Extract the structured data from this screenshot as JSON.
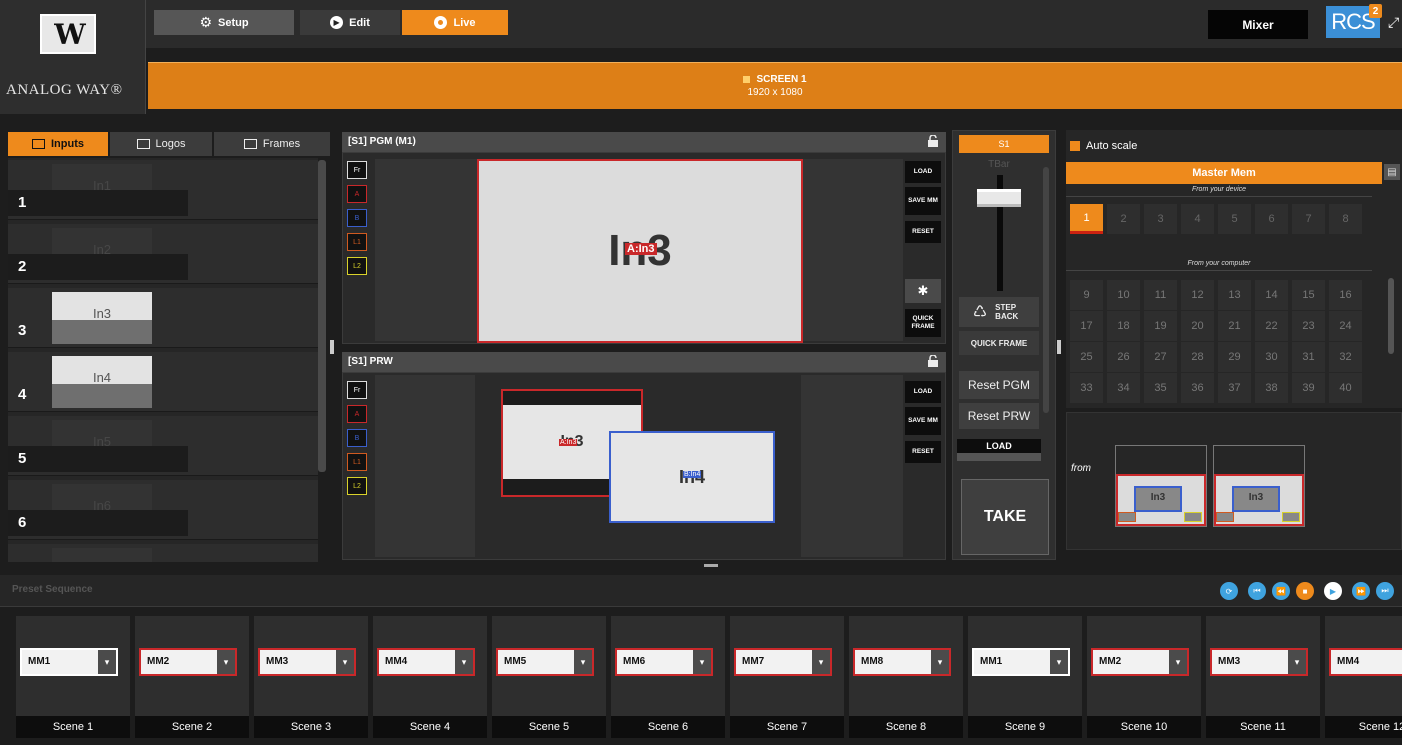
{
  "brand": {
    "logo_text": "ANALOG WAY®",
    "logo_mark": "W",
    "rcs_text": "RCS",
    "rcs_version": "2"
  },
  "modes": {
    "setup": "Setup",
    "edit": "Edit",
    "live": "Live"
  },
  "mixer_label": "Mixer",
  "screen": {
    "title": "SCREEN 1",
    "resolution": "1920 x 1080"
  },
  "input_tabs": {
    "inputs": "Inputs",
    "logos": "Logos",
    "frames": "Frames"
  },
  "inputs": [
    {
      "num": "1",
      "name": "In1"
    },
    {
      "num": "2",
      "name": "In2"
    },
    {
      "num": "3",
      "name": "In3"
    },
    {
      "num": "4",
      "name": "In4"
    },
    {
      "num": "5",
      "name": "In5"
    },
    {
      "num": "6",
      "name": "In6"
    }
  ],
  "program": {
    "header": "[S1] PGM (M1)",
    "source_text": "In3",
    "layer_tag": "A:In3"
  },
  "preview": {
    "header": "[S1] PRW",
    "layer_a_text": "In3",
    "layer_a_tag": "A:In3",
    "layer_b_text": "In4",
    "layer_b_tag": "B:In4"
  },
  "layer_buttons": {
    "fr": "Fr",
    "a": "A",
    "b": "B",
    "l1": "L1",
    "l2": "L2"
  },
  "monitor_buttons": {
    "load": "LOAD",
    "save_mm": "SAVE MM",
    "reset": "RESET",
    "quick_frame": "QUICK FRAME",
    "freeze_icon": "✱"
  },
  "tbar": {
    "screen": "S1",
    "label": "TBar",
    "step_back": "STEP BACK",
    "quick_frame": "QUICK FRAME",
    "reset_pgm": "Reset PGM",
    "reset_prw": "Reset PRW",
    "load": "LOAD",
    "take": "TAKE"
  },
  "master_mem": {
    "auto_scale": "Auto scale",
    "title": "Master Mem",
    "from_device": "From your device",
    "from_computer": "From your computer",
    "device_slots": [
      "1",
      "2",
      "3",
      "4",
      "5",
      "6",
      "7",
      "8"
    ],
    "computer_slots": [
      "9",
      "10",
      "11",
      "12",
      "13",
      "14",
      "15",
      "16",
      "17",
      "18",
      "19",
      "20",
      "21",
      "22",
      "23",
      "24",
      "25",
      "26",
      "27",
      "28",
      "29",
      "30",
      "31",
      "32",
      "33",
      "34",
      "35",
      "36",
      "37",
      "38",
      "39",
      "40"
    ],
    "selected": "1"
  },
  "from_panel": {
    "label": "from",
    "thumb_text": "In3"
  },
  "preset_sequence": {
    "title": "Preset Sequence"
  },
  "scenes": [
    {
      "mm": "MM1",
      "label": "Scene 1"
    },
    {
      "mm": "MM2",
      "label": "Scene 2"
    },
    {
      "mm": "MM3",
      "label": "Scene 3"
    },
    {
      "mm": "MM4",
      "label": "Scene 4"
    },
    {
      "mm": "MM5",
      "label": "Scene 5"
    },
    {
      "mm": "MM6",
      "label": "Scene 6"
    },
    {
      "mm": "MM7",
      "label": "Scene 7"
    },
    {
      "mm": "MM8",
      "label": "Scene 8"
    },
    {
      "mm": "MM1",
      "label": "Scene 9"
    },
    {
      "mm": "MM2",
      "label": "Scene 10"
    },
    {
      "mm": "MM3",
      "label": "Scene 11"
    },
    {
      "mm": "MM4",
      "label": "Scene 12"
    }
  ],
  "colors": {
    "accent": "#ee8a1c",
    "program_red": "#c9282a",
    "preview_blue": "#3a5fcd",
    "layer_yellow": "#d9d22a",
    "control_blue": "#3fa3df"
  }
}
